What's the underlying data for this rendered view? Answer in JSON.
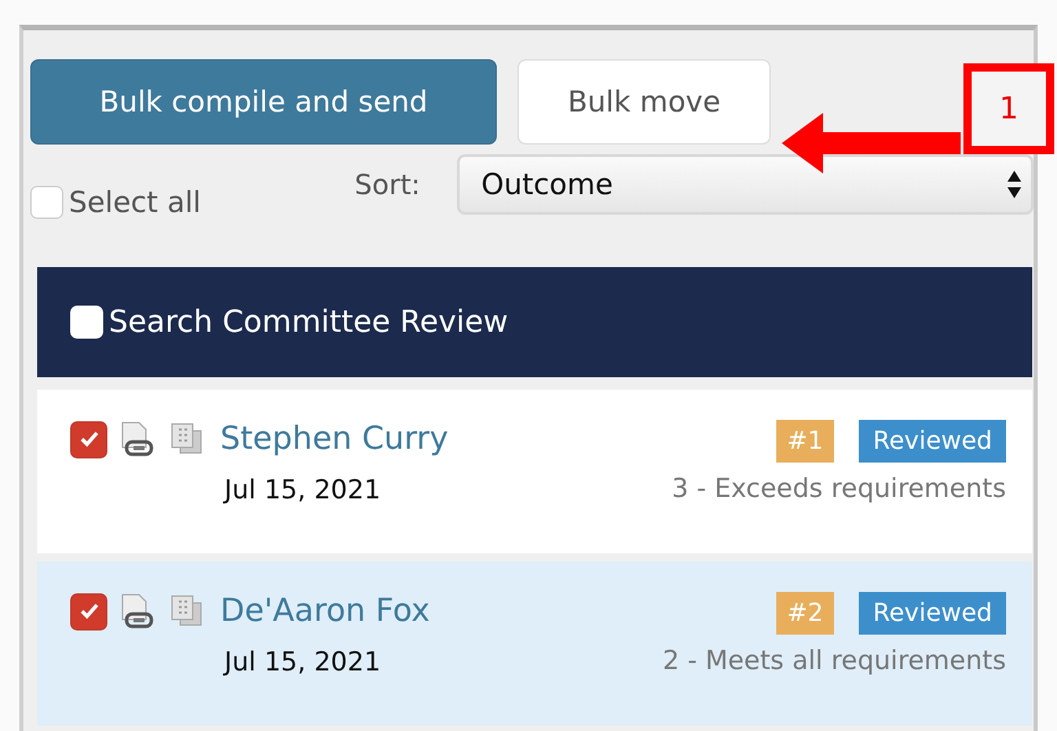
{
  "toolbar": {
    "buttons": [
      {
        "label": "Bulk compile and send",
        "kind": "primary"
      },
      {
        "label": "Bulk move",
        "kind": "default"
      }
    ]
  },
  "callout": {
    "label": "1"
  },
  "select_all": {
    "label": "Select all",
    "checked": false
  },
  "sort": {
    "label": "Sort:",
    "value": "Outcome"
  },
  "group": {
    "title": "Search Committee Review",
    "checked": false,
    "rows": [
      {
        "name": "Stephen Curry",
        "date": "Jul 15, 2021",
        "rank": "#1",
        "status": "Reviewed",
        "outcome": "3 - Exceeds requirements",
        "checked": true,
        "selected": false
      },
      {
        "name": "De'Aaron Fox",
        "date": "Jul 15, 2021",
        "rank": "#2",
        "status": "Reviewed",
        "outcome": "2 - Meets all requirements",
        "checked": true,
        "selected": true
      }
    ]
  }
}
